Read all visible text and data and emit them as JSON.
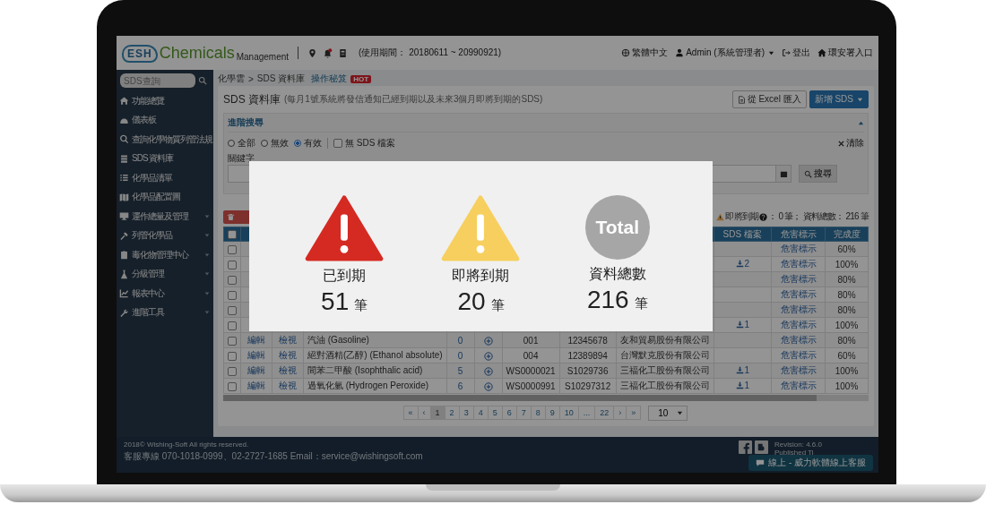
{
  "header": {
    "logo_badge": "ESH",
    "logo_title": "Chemicals",
    "logo_subtitle": "Management",
    "has_notification": true,
    "period": "(使用期間： 20180611 ~ 20990921)",
    "language": "繁體中文",
    "user": "Admin (系統管理者)",
    "logout": "登出",
    "portal": "環安署入口"
  },
  "sidebar": {
    "search_placeholder": "SDS查詢",
    "items": [
      {
        "label": "功能總覽",
        "expandable": false
      },
      {
        "label": "儀表板",
        "expandable": false
      },
      {
        "label": "查詢化學物質列管法規",
        "expandable": false
      },
      {
        "label": "SDS 資料庫",
        "expandable": false
      },
      {
        "label": "化學品清單",
        "expandable": false
      },
      {
        "label": "化學品配置圖",
        "expandable": false
      },
      {
        "label": "運作總量及管理",
        "expandable": true
      },
      {
        "label": "列管化學品",
        "expandable": true
      },
      {
        "label": "毒化物管理中心",
        "expandable": true
      },
      {
        "label": "分級管理",
        "expandable": true
      },
      {
        "label": "報表中心",
        "expandable": true
      },
      {
        "label": "進階工具",
        "expandable": true
      }
    ]
  },
  "breadcrumb": {
    "items": [
      "化學雲",
      "SDS 資料庫"
    ],
    "separator": ">",
    "guide_link": "操作秘笈",
    "badge": "HOT"
  },
  "page": {
    "title": "SDS 資料庫",
    "note": "(每月1號系統將發信通知已經到期以及未來3個月即將到期的SDS)",
    "buttons": [
      {
        "label": "從 Excel 匯入",
        "kind": "import"
      },
      {
        "label": "新增 SDS",
        "kind": "primary"
      }
    ]
  },
  "advanced_search": {
    "title": "進階搜尋",
    "expanded": true,
    "filters": [
      {
        "label": "全部",
        "selected": false
      },
      {
        "label": "無效",
        "selected": false
      },
      {
        "label": "有效",
        "selected": true
      }
    ],
    "no_sds_file": {
      "label": "無 SDS 檔案",
      "checked": false
    },
    "clear": "清除",
    "keyword_label": "關鍵字",
    "search_button": "搜尋"
  },
  "summary": {
    "upcoming_label": "即將到期",
    "upcoming_tail": "： 0 筆； 資料總數： 216 筆"
  },
  "table": {
    "all_checked": false,
    "columns": {
      "sds_file": "SDS 檔案",
      "hazard": "危害標示",
      "completion": "完成度"
    },
    "rows": [
      {
        "checked": false,
        "hazard": "危害標示",
        "completion": "60%"
      },
      {
        "checked": false,
        "sds_file": "2",
        "hazard": "危害標示",
        "completion": "100%"
      },
      {
        "checked": false,
        "hazard": "危害標示",
        "completion": "80%"
      },
      {
        "checked": false,
        "hazard": "危害標示",
        "completion": "80%"
      },
      {
        "checked": false,
        "hazard": "危害標示",
        "completion": "80%"
      },
      {
        "checked": false,
        "sds_file": "1",
        "hazard": "危害標示",
        "completion": "100%"
      },
      {
        "checked": false,
        "edit": "編輯",
        "view": "檢視",
        "name": "汽油 (Gasoline)",
        "count": "0",
        "sds_index": "001",
        "code": "12345678",
        "supplier": "友和貿易股份有限公司",
        "hazard": "危害標示",
        "completion": "80%"
      },
      {
        "checked": false,
        "edit": "編輯",
        "view": "檢視",
        "name": "絕對酒精(乙醇) (Ethanol absolute)",
        "count": "0",
        "sds_index": "004",
        "code": "12389894",
        "supplier": "台灣默克股份有限公司",
        "hazard": "危害標示",
        "completion": "60%"
      },
      {
        "checked": false,
        "edit": "編輯",
        "view": "檢視",
        "name": "間苯二甲酸 (Isophthalic acid)",
        "count": "5",
        "sds_index": "WS0000021",
        "code": "S1029736",
        "supplier": "三福化工股份有限公司",
        "sds_file": "1",
        "hazard": "危害標示",
        "completion": "100%"
      },
      {
        "checked": false,
        "edit": "編輯",
        "view": "檢視",
        "name": "過氧化氫 (Hydrogen Peroxide)",
        "count": "6",
        "sds_index": "WS0000991",
        "code": "S10297312",
        "supplier": "三福化工股份有限公司",
        "sds_file": "1",
        "hazard": "危害標示",
        "completion": "100%"
      }
    ]
  },
  "pagination": {
    "pages": [
      {
        "label": "«",
        "selected": false
      },
      {
        "label": "‹",
        "selected": false
      },
      {
        "label": "1",
        "selected": true
      },
      {
        "label": "2",
        "selected": false
      },
      {
        "label": "3",
        "selected": false
      },
      {
        "label": "4",
        "selected": false
      },
      {
        "label": "5",
        "selected": false
      },
      {
        "label": "6",
        "selected": false
      },
      {
        "label": "7",
        "selected": false
      },
      {
        "label": "8",
        "selected": false
      },
      {
        "label": "9",
        "selected": false
      },
      {
        "label": "10",
        "selected": false
      },
      {
        "label": "...",
        "selected": false
      },
      {
        "label": "22",
        "selected": false
      },
      {
        "label": "›",
        "selected": false
      },
      {
        "label": "»",
        "selected": false
      }
    ],
    "page_size": "10"
  },
  "footer": {
    "copyright": "2018© Wishing-Soft All rights reserved.",
    "contact": "客服專線 070-1018-0999、02-2727-1685 Email：service@wishingsoft.com",
    "revision": "Revision: 4.6.0",
    "published": "Published Ti",
    "chat": "線上 - 威力軟體線上客服"
  },
  "alert": {
    "items": [
      {
        "kind": "expired",
        "label": "已到期",
        "count": "51",
        "unit": "筆"
      },
      {
        "kind": "upcoming",
        "label": "即將到期",
        "count": "20",
        "unit": "筆"
      },
      {
        "kind": "total",
        "badge": "Total",
        "label": "資料總數",
        "count": "216",
        "unit": "筆"
      }
    ]
  }
}
